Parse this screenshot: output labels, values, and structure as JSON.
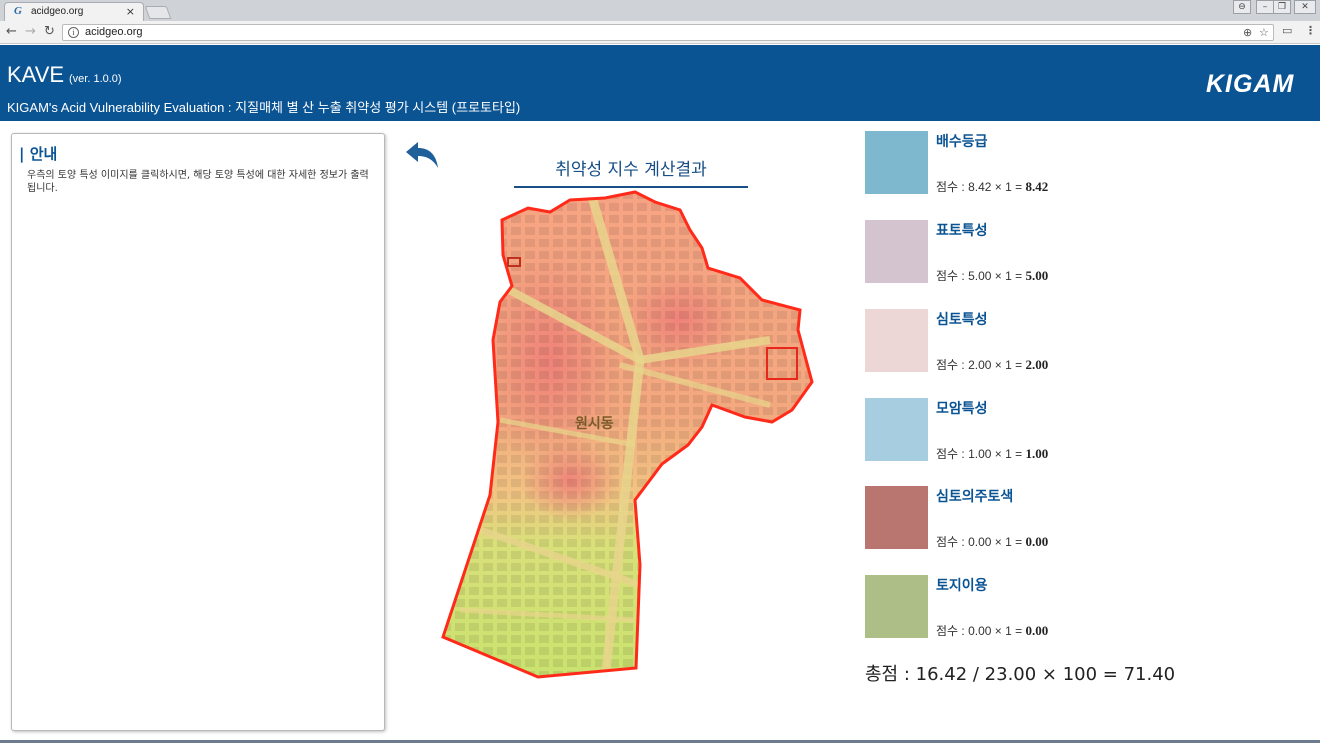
{
  "browser": {
    "tab_title": "acidgeo.org",
    "tab_favicon": "G",
    "tab_close": "×",
    "url": "acidgeo.org",
    "icons": [
      "back-arrow-icon",
      "forward-arrow-icon",
      "reload-icon",
      "info-icon",
      "zoom-icon",
      "star-icon",
      "cast-icon",
      "menu-icon"
    ]
  },
  "header": {
    "title": "KAVE",
    "version": "(ver. 1.0.0)",
    "subtitle": "KIGAM's Acid Vulnerability Evaluation : 지질매체 별 산 누출 취약성 평가 시스템 (프로토타입)",
    "logo_text": "KIGAM",
    "background_color": "#0b5494"
  },
  "info_panel": {
    "title": "| 안내",
    "text": "우측의 토양 특성 이미지를 클릭하시면, 해당 토양 특성에 대한 자세한 정보가 출력됩니다."
  },
  "map": {
    "title": "취약성 지수 계산결과",
    "place_label": "원시동"
  },
  "legend": {
    "items": [
      {
        "name": "배수등급",
        "score_prefix": "점수 : 8.42 × 1 = ",
        "score_value": "8.42",
        "color": "#7db8cf"
      },
      {
        "name": "표토특성",
        "score_prefix": "점수 : 5.00 × 1 = ",
        "score_value": "5.00",
        "color": "#d4c4d0"
      },
      {
        "name": "심토특성",
        "score_prefix": "점수 : 2.00 × 1 = ",
        "score_value": "2.00",
        "color": "#ecd6d6"
      },
      {
        "name": "모암특성",
        "score_prefix": "점수 : 1.00 × 1 = ",
        "score_value": "1.00",
        "color": "#a6cde0"
      },
      {
        "name": "심토의주토색",
        "score_prefix": "점수 : 0.00 × 1 = ",
        "score_value": "0.00",
        "color": "#b97570"
      },
      {
        "name": "토지이용",
        "score_prefix": "점수 : 0.00 × 1 = ",
        "score_value": "0.00",
        "color": "#adbe86"
      }
    ],
    "total": "총점 : 16.42 / 23.00 × 100 = 71.40"
  }
}
